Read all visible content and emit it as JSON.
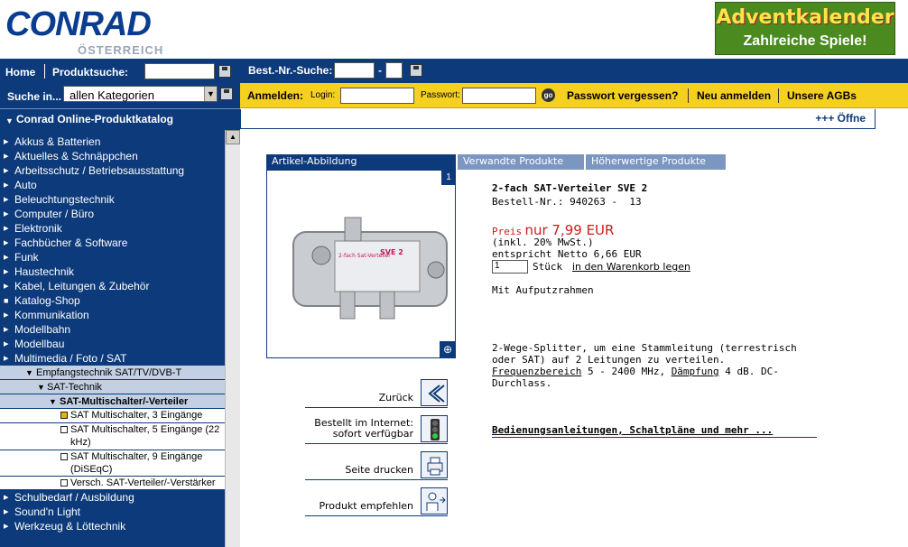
{
  "header": {
    "logo_word": "CONRAD",
    "logo_sub": "ÖSTERREICH",
    "banner_line1": "Adventkalender",
    "banner_line2": "Zahlreiche Spiele!"
  },
  "topbar": {
    "home": "Home",
    "product_search": "Produktsuche:",
    "search_in": "Suche in...",
    "category_select": "allen Kategorien",
    "order_no_search": "Best.-Nr.-Suche:",
    "dash": "-"
  },
  "login": {
    "title": "Anmelden:",
    "login_label": "Login:",
    "password_label": "Passwort:",
    "go": "go",
    "forgot": "Passwort vergessen?",
    "register": "Neu anmelden",
    "terms": "Unsere AGBs"
  },
  "catalog": {
    "title": "Conrad Online-Produktkatalog",
    "items": [
      "Akkus & Batterien",
      "Aktuelles & Schnäppchen",
      "Arbeitsschutz / Betriebsausstattung",
      "Auto",
      "Beleuchtungstechnik",
      "Computer / Büro",
      "Elektronik",
      "Fachbücher & Software",
      "Funk",
      "Haustechnik",
      "Kabel, Leitungen & Zubehör",
      "Katalog-Shop",
      "Kommunikation",
      "Modellbahn",
      "Modellbau",
      "Multimedia / Foto / SAT"
    ],
    "sub_level1": "Empfangstechnik SAT/TV/DVB-T",
    "sub_level2": "SAT-Technik",
    "sub_level3": "SAT-Multischalter/-Verteiler",
    "leaves": [
      "SAT Multischalter, 3 Eingänge",
      "SAT Multischalter, 5 Eingänge (22 kHz)",
      "SAT Multischalter, 9 Eingänge (DiSEqC)",
      "Versch. SAT-Verteiler/-Verstärker"
    ],
    "bottom_items": [
      "Schulbedarf / Ausbildung",
      "Sound'n Light",
      "Werkzeug & Löttechnik"
    ]
  },
  "main": {
    "open_text": "+++ Öffne",
    "tabs": [
      "Artikel-Abbildung",
      "Verwandte Produkte",
      "Höherwertige Produkte"
    ],
    "image_badge": "1",
    "product_title": "2-fach SAT-Verteiler SVE 2",
    "order_no": "Bestell-Nr.: 940263 -  13",
    "price_label": "Preis",
    "price_value": "nur 7,99 EUR",
    "vat": "(inkl. 20% MwSt.)",
    "net": "entspricht Netto 6,66 EUR",
    "qty_value": "1",
    "qty_unit": "Stück",
    "add_to_cart": "in den Warenkorb legen",
    "feature": "Mit Aufputzrahmen",
    "desc_pre": "2-Wege-Splitter, um eine Stammleitung (terrestrisch oder SAT) auf 2 Leitungen zu verteilen.",
    "desc_link1": "Frequenzbereich",
    "desc_mid": "5 - 2400 MHz,",
    "desc_link2": "Dämpfung",
    "desc_post": "4 dB. DC-Durchlass.",
    "manuals": "Bedienungsanleitungen, Schaltpläne und mehr ...",
    "device_label_title": "SVE 2",
    "device_label_text": "2-fach Sat-Verteiler"
  },
  "actions": {
    "back": "Zurück",
    "ordered_line1": "Bestellt im Internet:",
    "ordered_line2": "sofort verfügbar",
    "print": "Seite drucken",
    "recommend": "Produkt empfehlen"
  }
}
